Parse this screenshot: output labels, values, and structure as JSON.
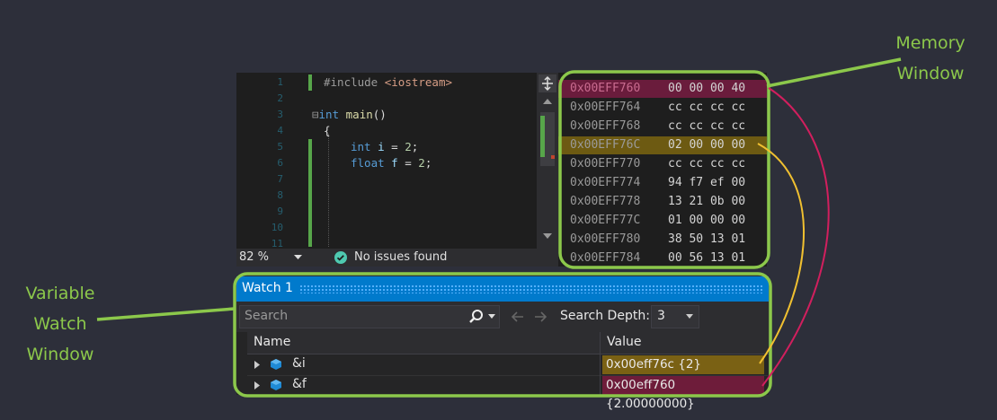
{
  "annotations": {
    "memory_window": [
      "Memory",
      "Window"
    ],
    "watch_window": [
      "Variable",
      "Watch",
      "Window"
    ]
  },
  "editor": {
    "line_numbers": [
      "1",
      "2",
      "3",
      "4",
      "5",
      "6",
      "7",
      "8",
      "9",
      "10",
      "11"
    ],
    "code": {
      "line1_directive": "#include",
      "line1_header": "<iostream>",
      "line3_collapse": "⊟",
      "line3_type": "int",
      "line3_func": "main",
      "line3_parens": "()",
      "line4": "{",
      "line5_type": "int",
      "line5_var": "i",
      "line5_op": "=",
      "line5_val": "2",
      "line5_end": ";",
      "line6_type": "float",
      "line6_var": "f",
      "line6_op": "=",
      "line6_val": "2",
      "line6_end": ";"
    },
    "split_icon": "split-icon",
    "zoom": "82 %",
    "status": "No issues found"
  },
  "memory": {
    "rows": [
      {
        "address": "0x00EFF760",
        "bytes": "00 00 00 40",
        "highlight": "#6a1c3c"
      },
      {
        "address": "0x00EFF764",
        "bytes": "cc cc cc cc",
        "highlight": ""
      },
      {
        "address": "0x00EFF768",
        "bytes": "cc cc cc cc",
        "highlight": ""
      },
      {
        "address": "0x00EFF76C",
        "bytes": "02 00 00 00",
        "highlight": "#6d5a12"
      },
      {
        "address": "0x00EFF770",
        "bytes": "cc cc cc cc",
        "highlight": ""
      },
      {
        "address": "0x00EFF774",
        "bytes": "94 f7 ef 00",
        "highlight": ""
      },
      {
        "address": "0x00EFF778",
        "bytes": "13 21 0b 00",
        "highlight": ""
      },
      {
        "address": "0x00EFF77C",
        "bytes": "01 00 00 00",
        "highlight": ""
      },
      {
        "address": "0x00EFF780",
        "bytes": "38 50 13 01",
        "highlight": ""
      },
      {
        "address": "0x00EFF784",
        "bytes": "00 56 13 01",
        "highlight": ""
      }
    ]
  },
  "watch": {
    "title": "Watch 1",
    "search_placeholder": "Search",
    "search_depth_label": "Search Depth:",
    "search_depth_value": "3",
    "columns": {
      "name": "Name",
      "value": "Value"
    },
    "rows": [
      {
        "name": "&i",
        "value": "0x00eff76c {2}",
        "color": "#7a6114"
      },
      {
        "name": "&f",
        "value": "0x00eff760 {2.00000000}",
        "color": "#6e1c3a"
      }
    ]
  },
  "colors": {
    "annotation_green": "#8cc84b",
    "watch_title_blue": "#007acc",
    "pink_line": "#d11f5e",
    "gold_line": "#f0c030"
  }
}
